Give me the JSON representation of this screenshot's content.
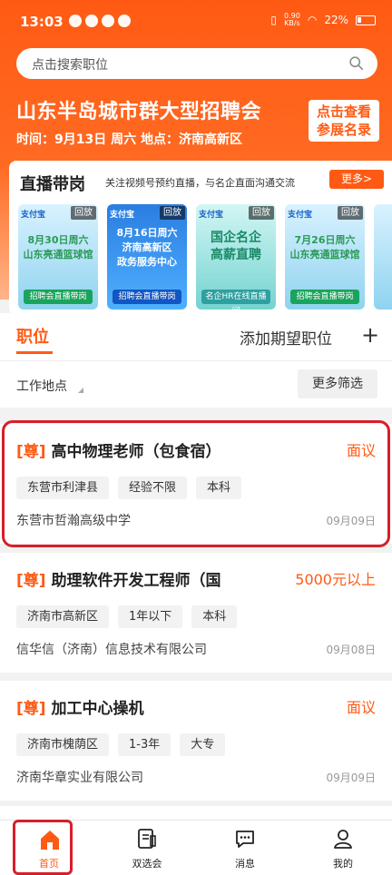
{
  "status": {
    "time": "13:03",
    "speed": "0.90\nKB/s",
    "battery": "22%"
  },
  "search": {
    "placeholder": "点击搜索职位"
  },
  "fair": {
    "title": "山东半岛城市群大型招聘会",
    "subtitle": "时间：9月13日 周六 地点：济南高新区",
    "button_line1": "点击查看",
    "button_line2": "参展名录"
  },
  "live": {
    "title": "直播带岗",
    "desc": "关注视频号预约直播，与名企直面沟通交流",
    "more": "更多>",
    "thumbs": [
      {
        "tag": "支付宝",
        "replay": "回放",
        "text": "8月30日周六\n山东亮通篮球馆",
        "foot": "招聘会直播带岗"
      },
      {
        "tag": "支付宝",
        "replay": "回放",
        "text": "8月16日周六\n济南高新区\n政务服务中心",
        "foot": "招聘会直播带岗"
      },
      {
        "tag": "支付宝",
        "replay": "回放",
        "text": "国企名企\n高薪直聘",
        "foot": "名企HR在线直播间"
      },
      {
        "tag": "支付宝",
        "replay": "回放",
        "text": "7月26日周六\n山东亮通篮球馆",
        "foot": "招聘会直播带岗"
      }
    ]
  },
  "tabs": {
    "position": "职位",
    "add_expect": "添加期望职位",
    "plus": "+"
  },
  "filter": {
    "location": "工作地点",
    "more": "更多筛选"
  },
  "jobs": [
    {
      "badge": "[尊]",
      "title": "高中物理老师（包食宿）",
      "salary": "面议",
      "tags": [
        "东营市利津县",
        "经验不限",
        "本科"
      ],
      "company": "东营市哲瀚高级中学",
      "date": "09月09日"
    },
    {
      "badge": "[尊]",
      "title": "助理软件开发工程师（国",
      "salary": "5000元以上",
      "tags": [
        "济南市高新区",
        "1年以下",
        "本科"
      ],
      "company": "信华信（济南）信息技术有限公司",
      "date": "09月08日"
    },
    {
      "badge": "[尊]",
      "title": "加工中心操机",
      "salary": "面议",
      "tags": [
        "济南市槐荫区",
        "1-3年",
        "大专"
      ],
      "company": "济南华章实业有限公司",
      "date": "09月09日"
    }
  ],
  "nav": [
    {
      "label": "首页",
      "icon": "home-icon"
    },
    {
      "label": "双选会",
      "icon": "doc-icon"
    },
    {
      "label": "消息",
      "icon": "message-icon"
    },
    {
      "label": "我的",
      "icon": "profile-icon"
    }
  ],
  "colors": {
    "accent": "#ff5a14",
    "highlight": "#d81e2a"
  }
}
